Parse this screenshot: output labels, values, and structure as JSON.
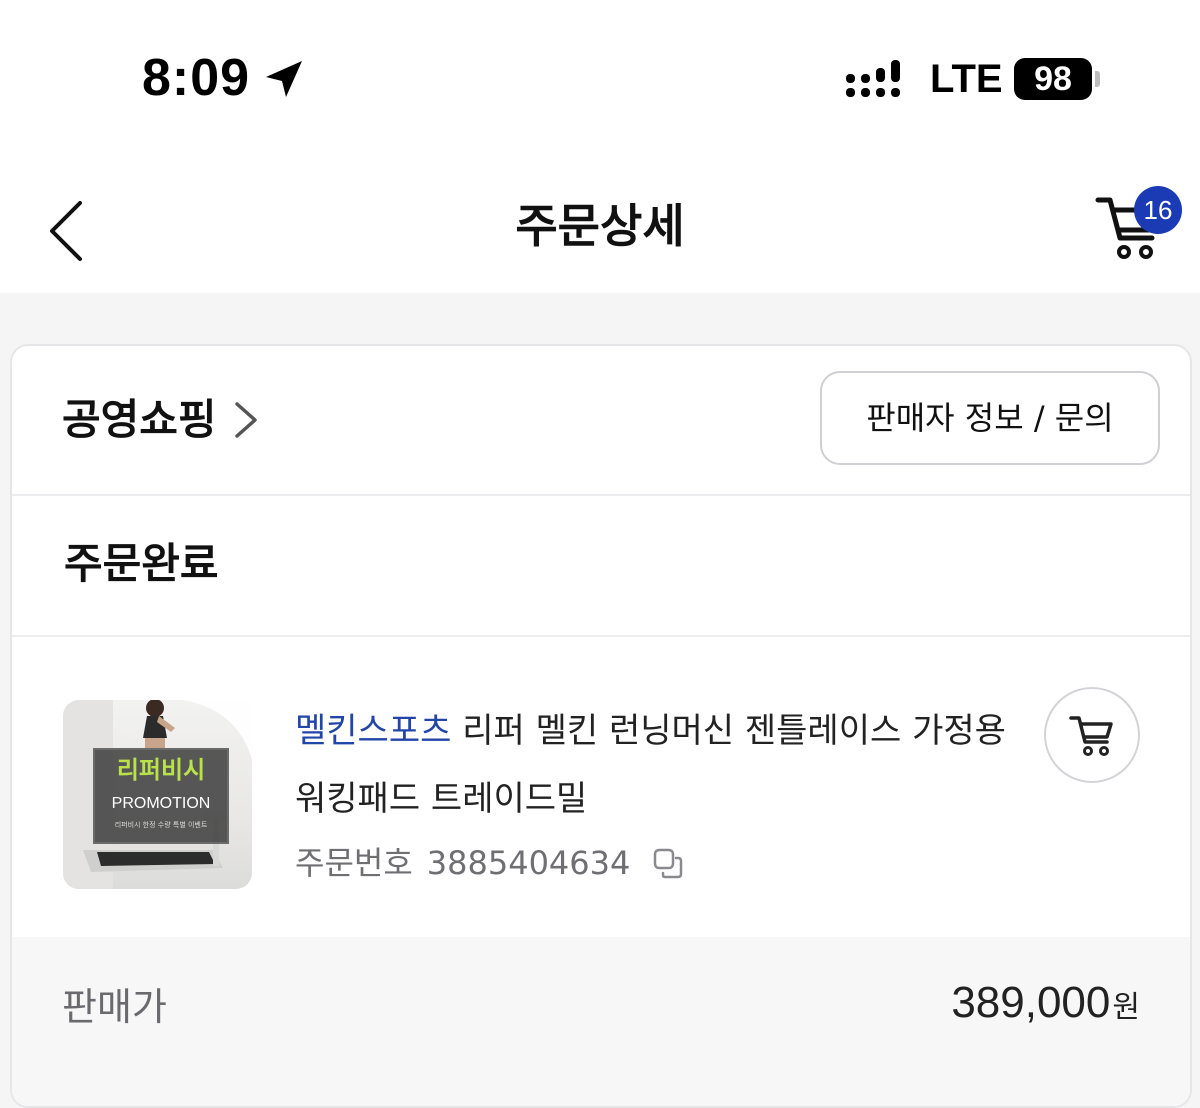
{
  "status_bar": {
    "time": "8:09",
    "network": "LTE",
    "battery": "98",
    "icons": [
      "location-arrow-icon",
      "signal-icon"
    ]
  },
  "nav": {
    "title": "주문상세",
    "back_icon": "chevron-left-icon",
    "cart_icon": "cart-icon",
    "cart_badge": "16"
  },
  "seller": {
    "name": "공영쇼핑",
    "info_button_label": "판매자 정보 / 문의"
  },
  "order": {
    "status": "주문완료",
    "number_label": "주문번호",
    "number": "3885404634"
  },
  "product": {
    "brand": "멜킨스포츠",
    "name": " 리퍼 멜킨 런닝머신 젠틀레이스 가정용 워킹패드 트레이드밀",
    "thumb_title": "리퍼비시",
    "thumb_sub": "PROMOTION",
    "thumb_small": "리퍼비시 한정 수량 특별 이벤트"
  },
  "price": {
    "label": "판매가",
    "amount": "389,000",
    "unit": "원"
  },
  "colors": {
    "brand_blue": "#2245a8",
    "badge_blue": "#1a3bb3",
    "thumb_accent": "#b9e24a"
  }
}
